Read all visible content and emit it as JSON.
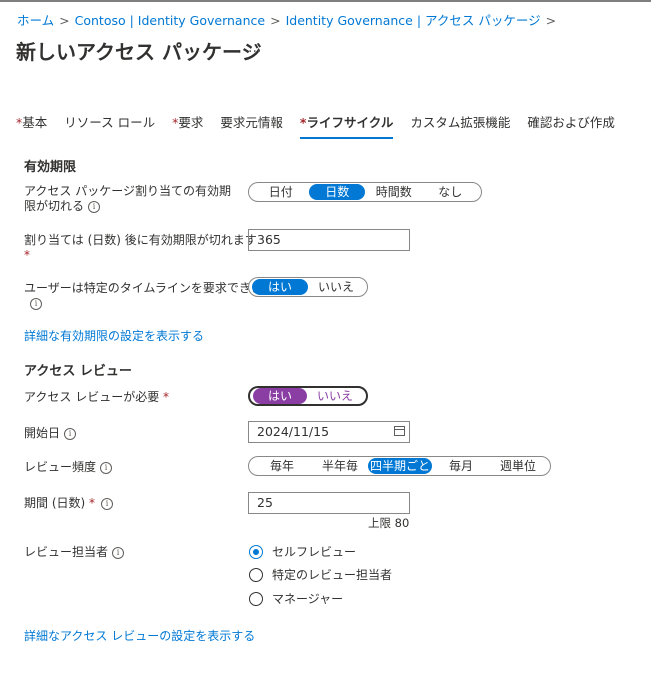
{
  "breadcrumb": {
    "home": "ホーム",
    "contoso": "Contoso | Identity Governance",
    "ig_packages": "Identity Governance | アクセス パッケージ",
    "sep": ">"
  },
  "header": {
    "title": "新しいアクセス パッケージ",
    "more": "..."
  },
  "tabs": [
    {
      "label": "基本",
      "required": "*"
    },
    {
      "label": "リソース ロール",
      "required": ""
    },
    {
      "label": "要求",
      "required": "*"
    },
    {
      "label": "要求元情報",
      "required": ""
    },
    {
      "label": "ライフサイクル",
      "required": "*"
    },
    {
      "label": "カスタム拡張機能",
      "required": ""
    },
    {
      "label": "確認および作成",
      "required": ""
    }
  ],
  "expiration": {
    "heading": "有効期限",
    "expires_label": "アクセス パッケージ割り当ての有効期限が切れる",
    "expires_options": [
      "日付",
      "日数",
      "時間数",
      "なし"
    ],
    "expires_selected": "日数",
    "days_label": "割り当ては (日数) 後に有効期限が切れます",
    "days_value": "365",
    "timeline_label": "ユーザーは特定のタイムラインを要求できます",
    "timeline_options": [
      "はい",
      "いいえ"
    ],
    "timeline_selected": "はい",
    "advanced_link": "詳細な有効期限の設定を表示する"
  },
  "review": {
    "heading": "アクセス レビュー",
    "required_label": "アクセス レビューが必要",
    "required_options": [
      "はい",
      "いいえ"
    ],
    "required_selected": "はい",
    "start_label": "開始日",
    "start_value": "2024/11/15",
    "freq_label": "レビュー頻度",
    "freq_options": [
      "毎年",
      "半年毎",
      "四半期ごと",
      "毎月",
      "週単位"
    ],
    "freq_selected": "四半期ごと",
    "duration_label": "期間 (日数)",
    "duration_value": "25",
    "duration_hint": "上限 80",
    "reviewers_label": "レビュー担当者",
    "reviewer_options": [
      "セルフレビュー",
      "特定のレビュー担当者",
      "マネージャー"
    ],
    "reviewer_selected": "セルフレビュー",
    "advanced_link": "詳細なアクセス レビューの設定を表示する"
  },
  "required_mark": "*",
  "info_glyph": "i",
  "colors": {
    "accent": "#0078d4",
    "purple": "#8a3ea3",
    "required": "#a4262c"
  }
}
